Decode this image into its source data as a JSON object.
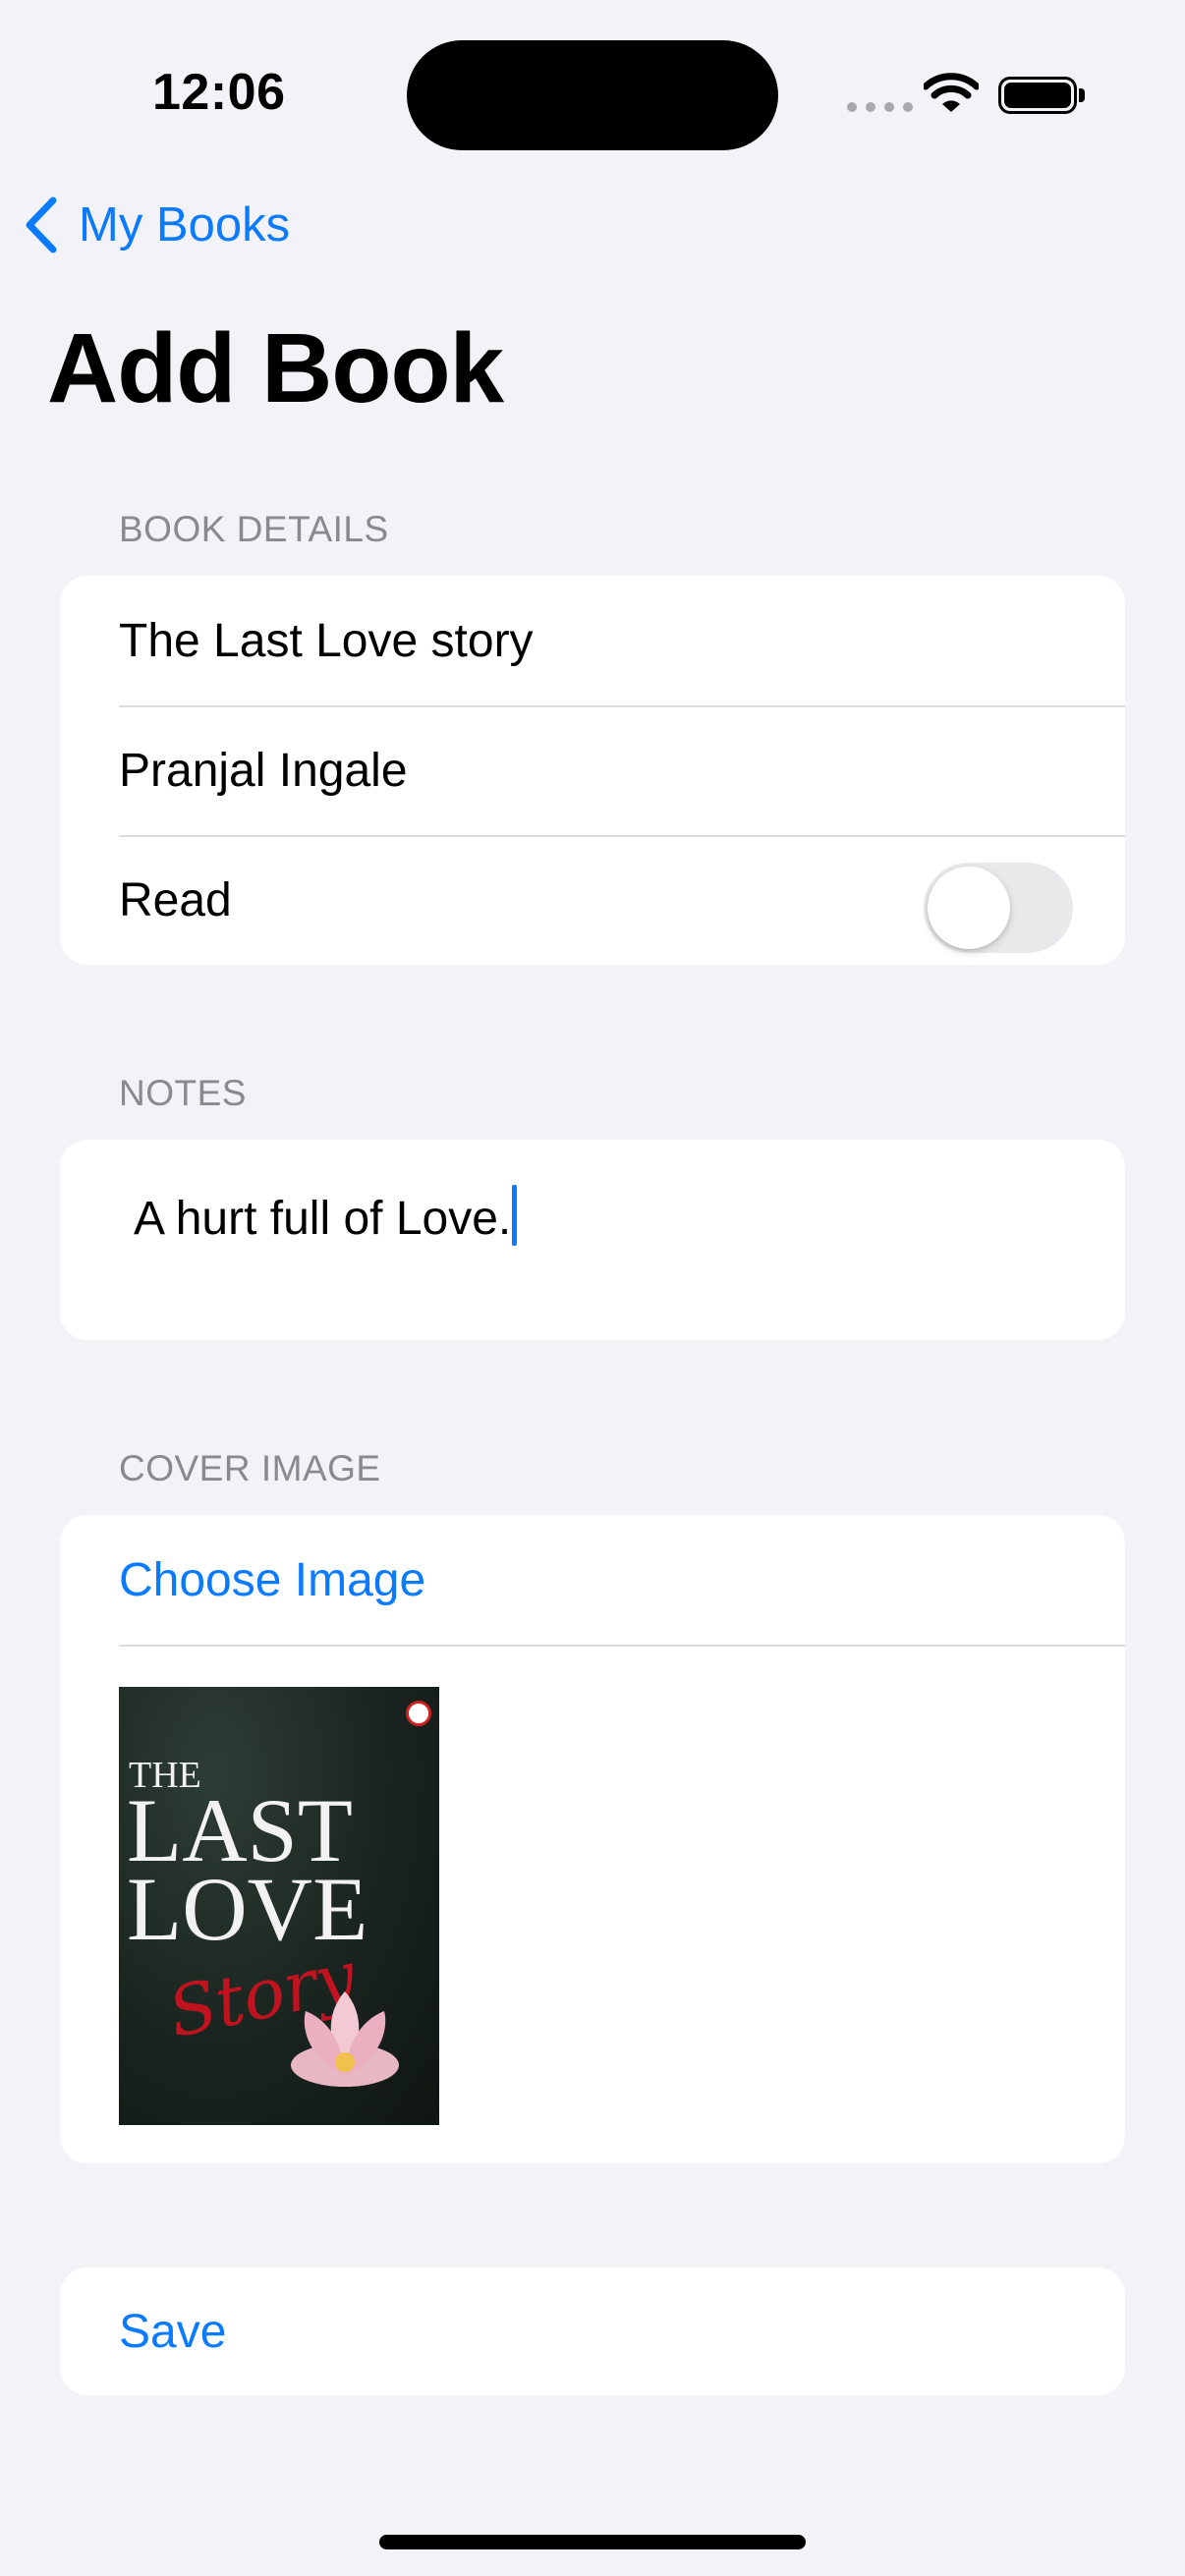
{
  "status_bar": {
    "time": "12:06"
  },
  "nav": {
    "back_label": "My Books",
    "title": "Add Book"
  },
  "book_details": {
    "header": "BOOK DETAILS",
    "title_value": "The Last Love story",
    "author_value": "Pranjal Ingale",
    "read_label": "Read",
    "read_on": false
  },
  "notes": {
    "header": "NOTES",
    "value": "A hurt full of Love."
  },
  "cover_image": {
    "header": "COVER IMAGE",
    "choose_label": "Choose Image",
    "cover_text": {
      "the": "THE",
      "last": "LAST",
      "love": "LOVE",
      "story": "Story"
    }
  },
  "save_label": "Save",
  "colors": {
    "accent": "#0a7aff",
    "background": "#f2f2f7",
    "card": "#ffffff",
    "secondary_text": "#8a8a8e"
  }
}
